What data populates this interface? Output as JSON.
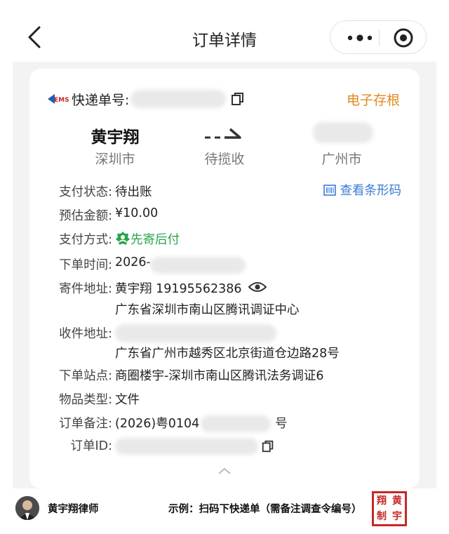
{
  "nav": {
    "title": "订单详情"
  },
  "header": {
    "tracking_label": "快递单号:",
    "e_stub": "电子存根"
  },
  "route": {
    "sender_name": "黄宇翔",
    "sender_city": "深圳市",
    "status": "待揽收",
    "receiver_city": "广州市"
  },
  "info": {
    "view_barcode": "查看条形码",
    "rows": [
      {
        "label": "支付状态:",
        "value": "待出账"
      },
      {
        "label": "预估金额:",
        "value": "¥10.00"
      },
      {
        "label": "支付方式:",
        "value": "先寄后付"
      },
      {
        "label": "下单时间:",
        "value": "2026-"
      },
      {
        "label": "寄件地址:",
        "value": "黄宇翔 19195562386",
        "line2": "广东省深圳市南山区腾讯调证中心"
      },
      {
        "label": "收件地址:",
        "value": "",
        "line2": "广东省广州市越秀区北京街道仓边路28号"
      },
      {
        "label": "下单站点:",
        "value": "商圈楼宇-深圳市南山区腾讯法务调证6"
      },
      {
        "label": "物品类型:",
        "value": "文件"
      },
      {
        "label": "订单备注:",
        "value": "(2026)粤0104",
        "suffix": "号"
      },
      {
        "label": "订单ID:",
        "value": ""
      }
    ]
  },
  "footer": {
    "name": "黄宇翔律师",
    "example": "示例：扫码下快递单（需备注调查令编号）",
    "seal_chars": [
      "翔",
      "黄",
      "制",
      "宇"
    ]
  },
  "colors": {
    "accent_orange": "#e08a1e",
    "link_blue": "#3a7bd5",
    "green": "#2ba24c",
    "seal_red": "#c62828"
  },
  "icons": {
    "ems_logo": "ems-logo",
    "copy": "copy-icon",
    "eye": "eye-icon",
    "barcode": "barcode-icon",
    "badge": "person-badge-icon"
  }
}
